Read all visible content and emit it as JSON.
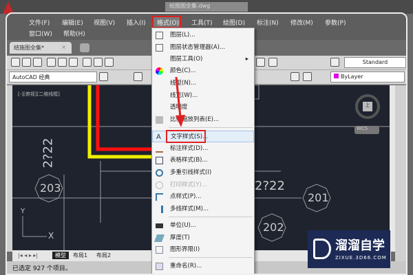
{
  "titlebar": {
    "document_title": "绘图图全集.dwg"
  },
  "menubar": {
    "items": [
      "文件(F)",
      "编辑(E)",
      "视图(V)",
      "插入(I)",
      "格式(O)",
      "工具(T)",
      "绘图(D)",
      "标注(N)",
      "修改(M)",
      "参数(P)",
      "窗口(W)",
      "帮助(H)"
    ]
  },
  "tabs": {
    "doc": "结施图全集*",
    "close": "×"
  },
  "toolbar": {
    "workspace": "AutoCAD 经典",
    "text_style": "Standard",
    "color": "ByLayer"
  },
  "menu": {
    "items": [
      "图层(L)...",
      "图层状态管理器(A)...",
      "图层工具(O)",
      "颜色(C)...",
      "线型(N)...",
      "线宽(W)...",
      "透明度",
      "比例缩放列表(E)...",
      "文字样式(S)...",
      "标注样式(D)...",
      "表格样式(B)...",
      "多重引线样式(I)",
      "打印样式(Y)...",
      "点样式(P)...",
      "多线样式(M)...",
      "单位(U)...",
      "厚度(T)",
      "图形界限(I)",
      "重命名(R)..."
    ],
    "submenu_arrow": "▸"
  },
  "drawing": {
    "viewport_label": "[-][俯视][二维线框]",
    "labels": [
      "2?22",
      "2?22",
      "203",
      "201",
      "202"
    ],
    "ucs_y": "Y",
    "ucs_x": "X",
    "compass_label": "上",
    "wcs": "WCS"
  },
  "layout_tabs": [
    "模型",
    "布局1",
    "布局2"
  ],
  "command": {
    "text": "已选定 927 个项目。"
  },
  "watermark": {
    "title": "溜溜自学",
    "url": "ZIXUE.3D66.COM"
  },
  "colors": {
    "highlight": "#e02020",
    "drawing_bg": "#1e232e",
    "polyline_red": "#ff1010",
    "polyline_yellow": "#f0f000"
  }
}
